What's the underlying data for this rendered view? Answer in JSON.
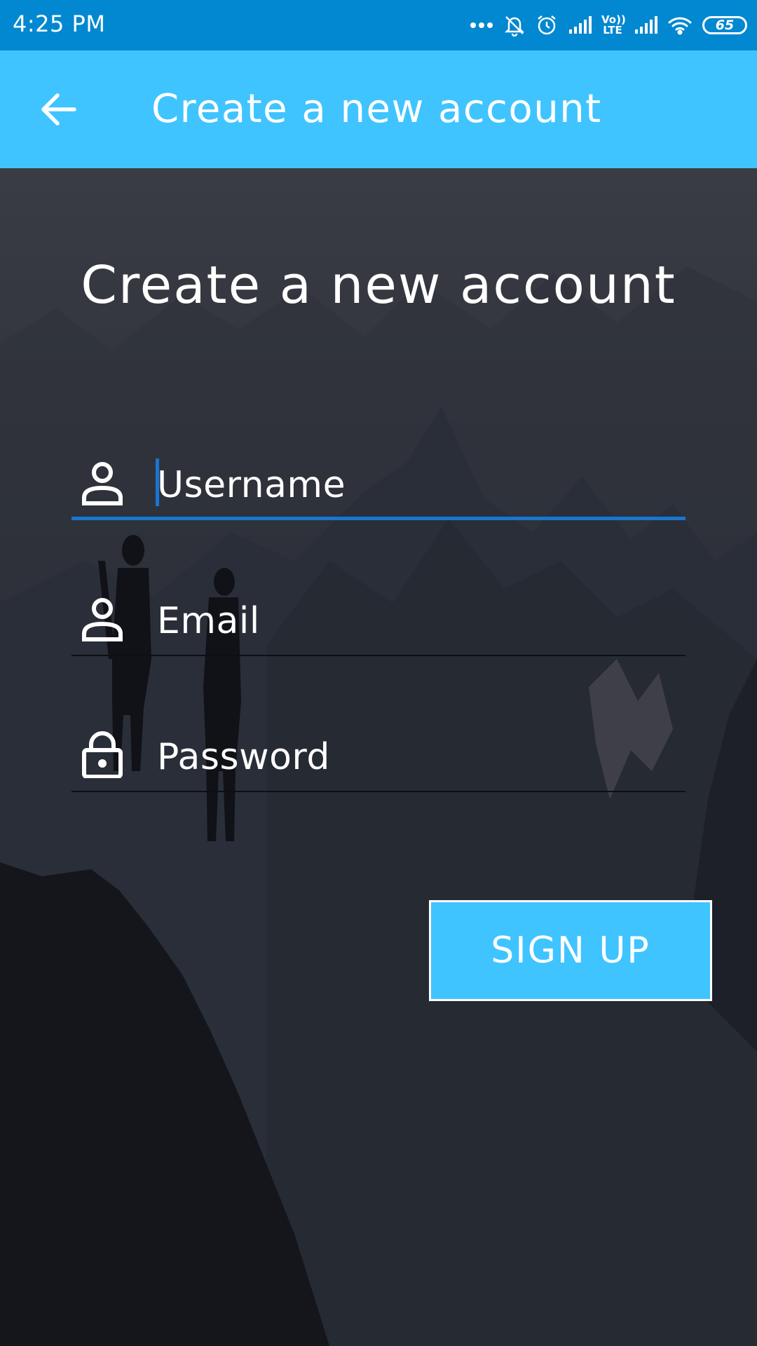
{
  "status_bar": {
    "time": "4:25 PM",
    "network_label": "Vo)) LTE",
    "battery": "65",
    "icons": [
      "more-dots-icon",
      "notifications-off-icon",
      "alarm-icon",
      "signal-icon",
      "lte-icon",
      "signal-icon",
      "wifi-icon",
      "battery-icon"
    ]
  },
  "app_bar": {
    "title": "Create a new account",
    "back_icon": "arrow-back-icon"
  },
  "form": {
    "heading": "Create a new account",
    "username": {
      "placeholder": "Username",
      "icon": "person-icon",
      "focused": true
    },
    "email": {
      "placeholder": "Email",
      "icon": "person-icon"
    },
    "password": {
      "placeholder": "Password",
      "icon": "lock-icon"
    },
    "submit_label": "SIGN UP"
  },
  "colors": {
    "status_bar": "#0288d1",
    "app_bar": "#40c4ff",
    "accent": "#1976d2",
    "button": "#40c4ff",
    "background": "#1c2029"
  }
}
